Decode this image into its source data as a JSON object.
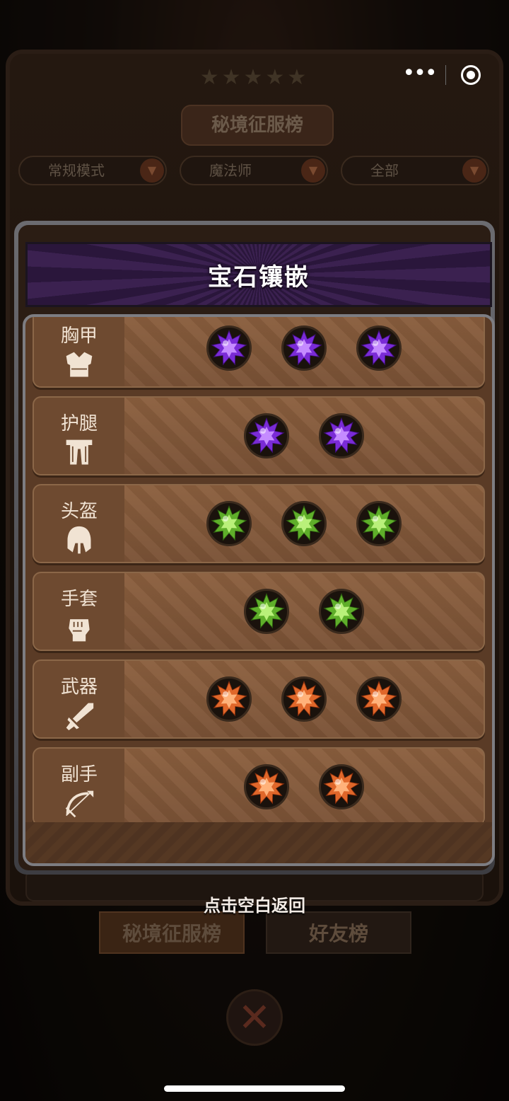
{
  "background": {
    "leaderboard_title": "秘境征服榜",
    "filters": [
      {
        "label": "常规模式"
      },
      {
        "label": "魔法师"
      },
      {
        "label": "全部"
      }
    ],
    "tabs": [
      {
        "label": "秘境征服榜"
      },
      {
        "label": "好友榜"
      }
    ],
    "close_icon": "close-x-icon"
  },
  "capsule": {
    "more_icon": "more-dots-icon",
    "close_icon": "target-icon"
  },
  "popup": {
    "title": "宝石镶嵌",
    "slots": [
      {
        "name": "胸甲",
        "icon": "chest-armor-icon",
        "gem_color": "purple",
        "gem_count": 3
      },
      {
        "name": "护腿",
        "icon": "leg-armor-icon",
        "gem_color": "purple",
        "gem_count": 2
      },
      {
        "name": "头盔",
        "icon": "helmet-icon",
        "gem_color": "green",
        "gem_count": 3
      },
      {
        "name": "手套",
        "icon": "gauntlet-icon",
        "gem_color": "green",
        "gem_count": 2
      },
      {
        "name": "武器",
        "icon": "sword-icon",
        "gem_color": "orange",
        "gem_count": 3
      },
      {
        "name": "副手",
        "icon": "bow-icon",
        "gem_color": "orange",
        "gem_count": 2
      }
    ]
  },
  "gem_colors": {
    "purple": {
      "base": "#7a2bd6",
      "light": "#c58bff",
      "dark": "#3e0f7a"
    },
    "green": {
      "base": "#5fae2a",
      "light": "#b9f07a",
      "dark": "#2c5e10"
    },
    "orange": {
      "base": "#e0672a",
      "light": "#ffb27a",
      "dark": "#8a2f0c"
    }
  },
  "back_hint": "点击空白返回"
}
